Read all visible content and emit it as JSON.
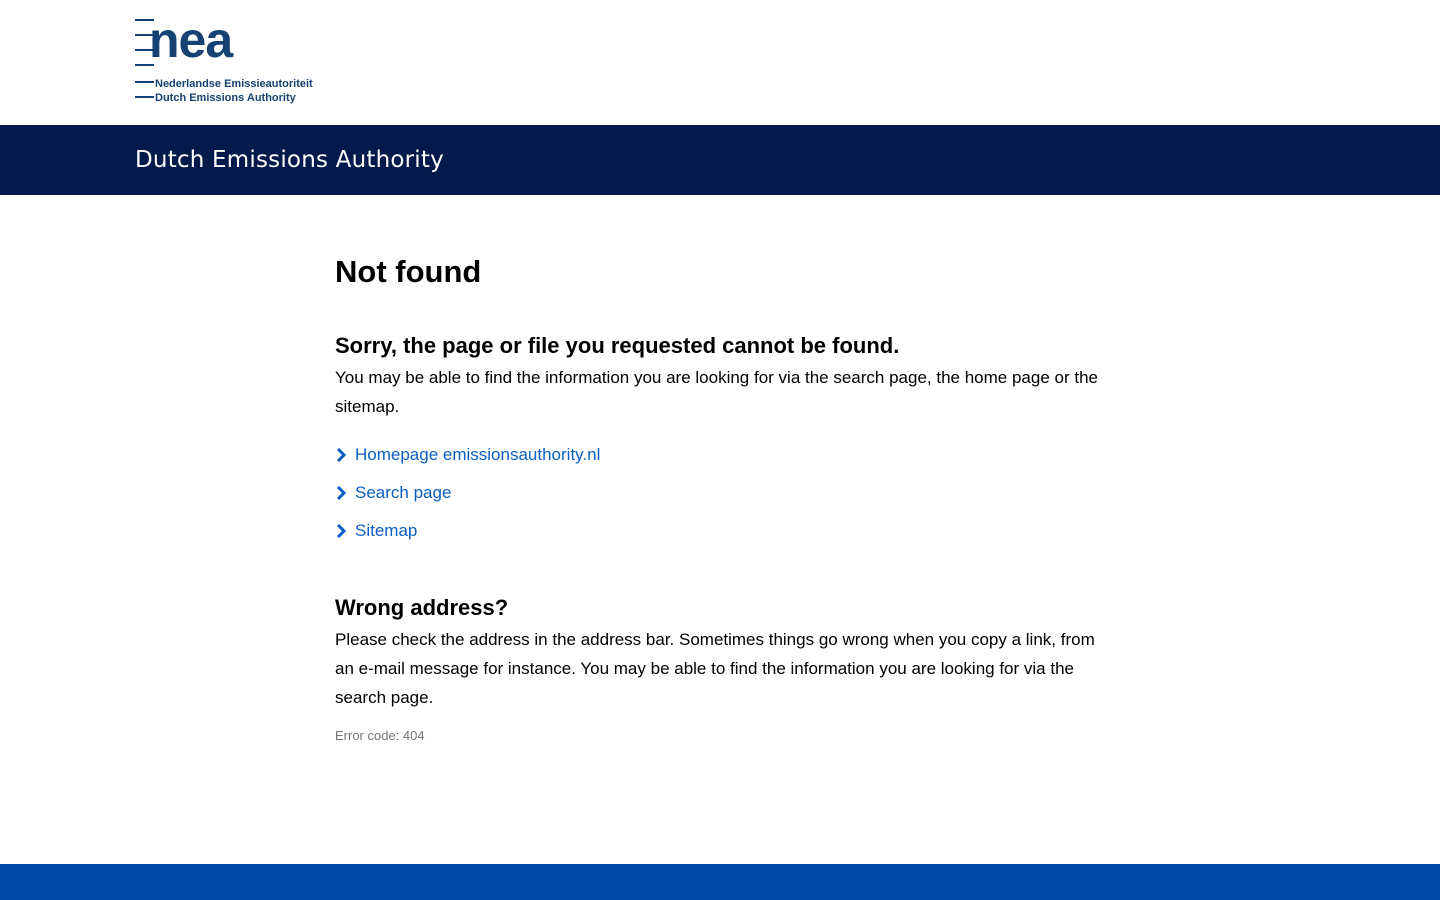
{
  "header": {
    "logo": {
      "wordmark": "nea",
      "line1": "Nederlandse Emissieautoriteit",
      "line2": "Dutch Emissions Authority"
    },
    "site_name": "Dutch Emissions Authority"
  },
  "main": {
    "title": "Not found",
    "sorry": {
      "heading": "Sorry, the page or file you requested cannot be found.",
      "text": "You may be able to find the information you are looking for via the search page, the home page or the sitemap."
    },
    "links": [
      {
        "label": "Homepage emissionsauthority.nl",
        "icon": "chevron-right-icon"
      },
      {
        "label": "Search page",
        "icon": "chevron-right-icon"
      },
      {
        "label": "Sitemap",
        "icon": "chevron-right-icon"
      }
    ],
    "wrong_address": {
      "heading": "Wrong address?",
      "text": "Please check the address in the address bar. Sometimes things go wrong when you copy a link, from an e-mail message for instance. You may be able to find the information you are looking for via the search page."
    },
    "error_code": "Error code: 404"
  },
  "colors": {
    "brand_dark": "#01194b",
    "logo_blue": "#154273",
    "link_blue": "#0b5fc4",
    "footer_blue": "#0049a8",
    "muted_text": "#757575"
  }
}
